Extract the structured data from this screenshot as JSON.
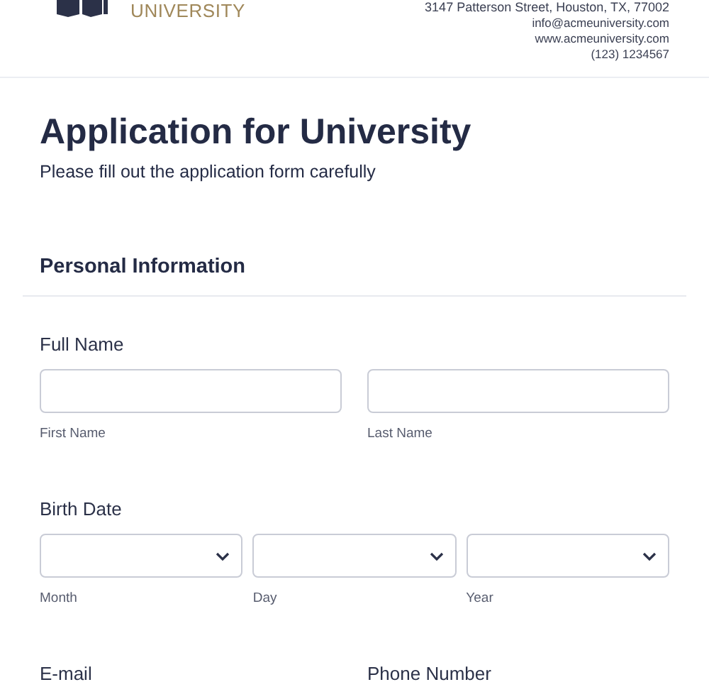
{
  "header": {
    "logo_text": "UNIVERSITY",
    "address": "3147 Patterson Street, Houston, TX, 77002",
    "email": "info@acmeuniversity.com",
    "website": "www.acmeuniversity.com",
    "phone": "(123) 1234567"
  },
  "form": {
    "title": "Application for University",
    "subtitle": "Please fill out the application form carefully",
    "section": "Personal Information",
    "fields": [
      {
        "kind": "text-pair",
        "label": "Full Name",
        "parts": [
          {
            "sublabel": "First Name"
          },
          {
            "sublabel": "Last Name"
          }
        ]
      },
      {
        "kind": "select-triple",
        "label": "Birth Date",
        "parts": [
          {
            "sublabel": "Month"
          },
          {
            "sublabel": "Day"
          },
          {
            "sublabel": "Year"
          }
        ]
      },
      {
        "kind": "label-pair",
        "labels": [
          "E-mail",
          "Phone Number"
        ]
      }
    ]
  }
}
